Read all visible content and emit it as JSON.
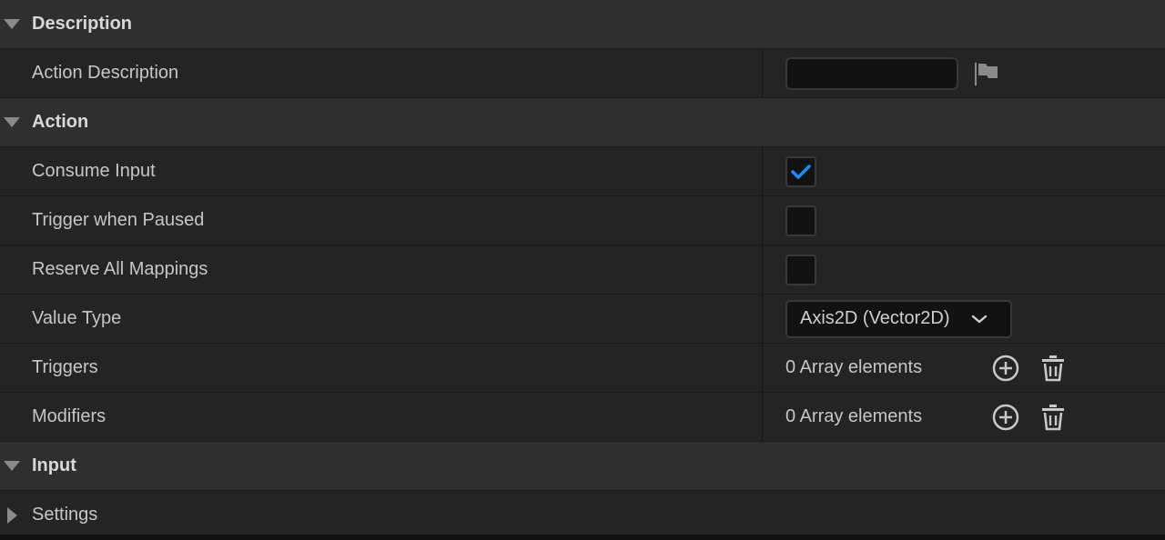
{
  "sections": {
    "description": {
      "title": "Description"
    },
    "action": {
      "title": "Action"
    },
    "input": {
      "title": "Input"
    }
  },
  "props": {
    "action_description": {
      "label": "Action Description",
      "value": ""
    },
    "consume_input": {
      "label": "Consume Input",
      "checked": true
    },
    "trigger_when_paused": {
      "label": "Trigger when Paused",
      "checked": false
    },
    "reserve_all_mappings": {
      "label": "Reserve All Mappings",
      "checked": false
    },
    "value_type": {
      "label": "Value Type",
      "selected": "Axis2D (Vector2D)"
    },
    "triggers": {
      "label": "Triggers",
      "value": "0 Array elements"
    },
    "modifiers": {
      "label": "Modifiers",
      "value": "0 Array elements"
    },
    "settings": {
      "label": "Settings"
    }
  },
  "colors": {
    "accent_check": "#1a8cff"
  },
  "icons": [
    "expand-arrow-icon",
    "collapse-arrow-icon",
    "localization-flag-icon",
    "checkmark-icon",
    "chevron-down-icon",
    "add-element-icon",
    "delete-elements-icon"
  ]
}
